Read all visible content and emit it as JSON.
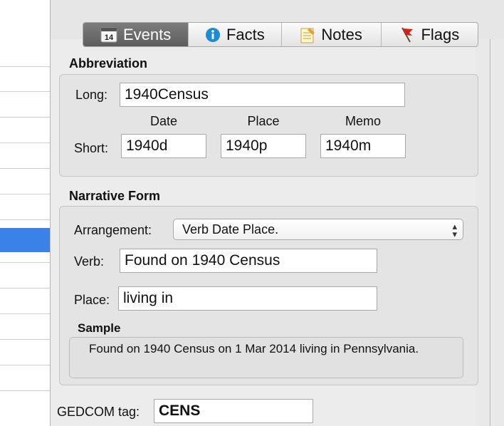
{
  "tabs": [
    {
      "label": "Events",
      "icon": "calendar-icon",
      "icon_text": "14",
      "active": true
    },
    {
      "label": "Facts",
      "icon": "info-icon",
      "active": false
    },
    {
      "label": "Notes",
      "icon": "notepad-icon",
      "active": false
    },
    {
      "label": "Flags",
      "icon": "flag-icon",
      "active": false
    }
  ],
  "abbreviation": {
    "title": "Abbreviation",
    "long_label": "Long:",
    "long_value": "1940Census",
    "short_label": "Short:",
    "columns": [
      "Date",
      "Place",
      "Memo"
    ],
    "short_values": [
      "1940d",
      "1940p",
      "1940m"
    ]
  },
  "narrative": {
    "title": "Narrative Form",
    "arrangement_label": "Arrangement:",
    "arrangement_value": "Verb Date Place.",
    "verb_label": "Verb:",
    "verb_value": "Found on 1940 Census",
    "place_label": "Place:",
    "place_value": "living in",
    "sample_label": "Sample",
    "sample_text": "Found on 1940 Census on 1 Mar 2014 living in Pennsylvania."
  },
  "gedcom": {
    "label": "GEDCOM tag:",
    "value": "CENS"
  },
  "colors": {
    "active_tab": "#6b6b6b",
    "selection": "#3b82e8",
    "info_icon": "#1f8ad6",
    "flag_icon": "#d02020"
  }
}
